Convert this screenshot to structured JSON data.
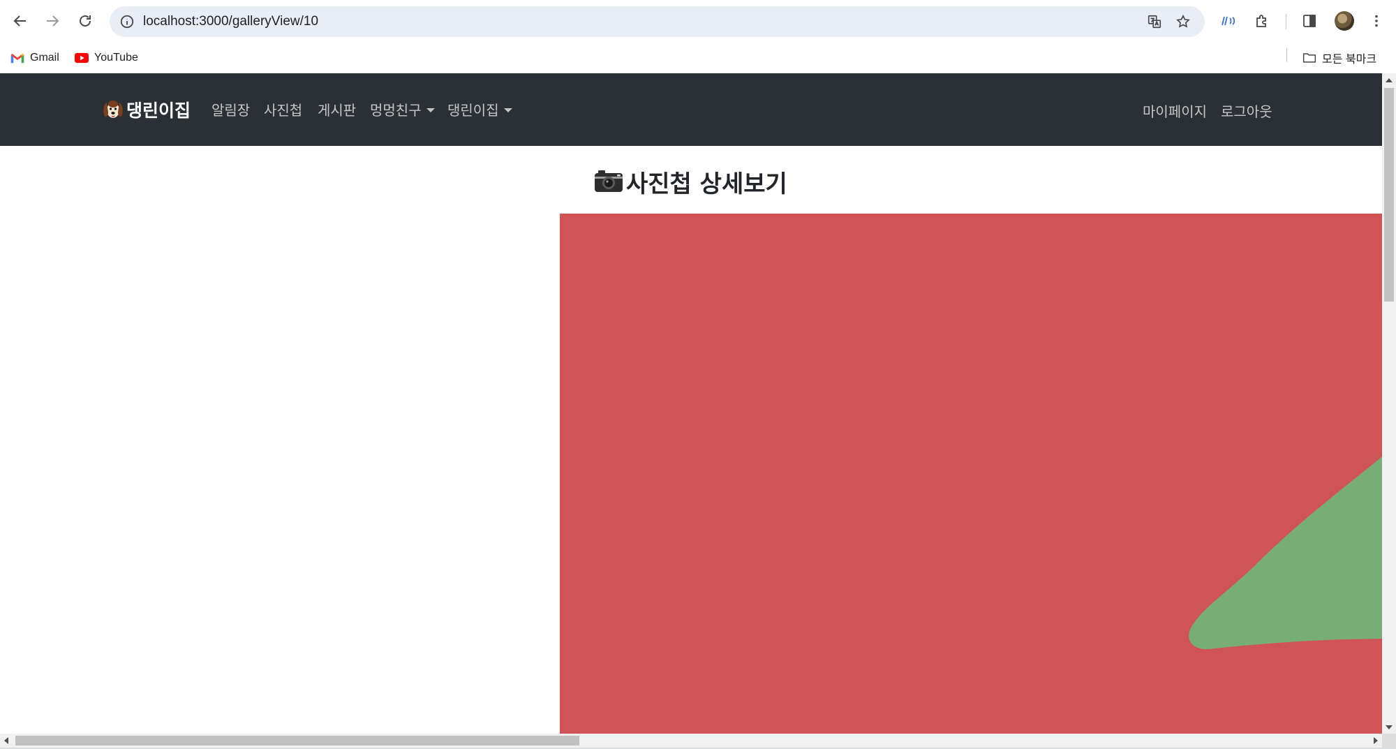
{
  "browser": {
    "url": "localhost:3000/galleryView/10",
    "bookmarks": [
      {
        "label": "Gmail",
        "icon": "gmail-icon"
      },
      {
        "label": "YouTube",
        "icon": "youtube-icon"
      }
    ],
    "all_bookmarks_label": "모든 북마크"
  },
  "site": {
    "brand": "댕린이집",
    "nav": [
      {
        "label": "알림장",
        "dropdown": false
      },
      {
        "label": "사진첩",
        "dropdown": false
      },
      {
        "label": "게시판",
        "dropdown": false
      },
      {
        "label": "멍멍친구",
        "dropdown": true
      },
      {
        "label": "댕린이집",
        "dropdown": true
      }
    ],
    "right_nav": [
      {
        "label": "마이페이지"
      },
      {
        "label": "로그아웃"
      }
    ],
    "colors": {
      "navbar": "#2b3035",
      "photo_background": "#d05456",
      "photo_shape": "#77ae76"
    }
  },
  "main": {
    "title": "사진첩 상세보기",
    "title_icon": "camera-icon"
  }
}
